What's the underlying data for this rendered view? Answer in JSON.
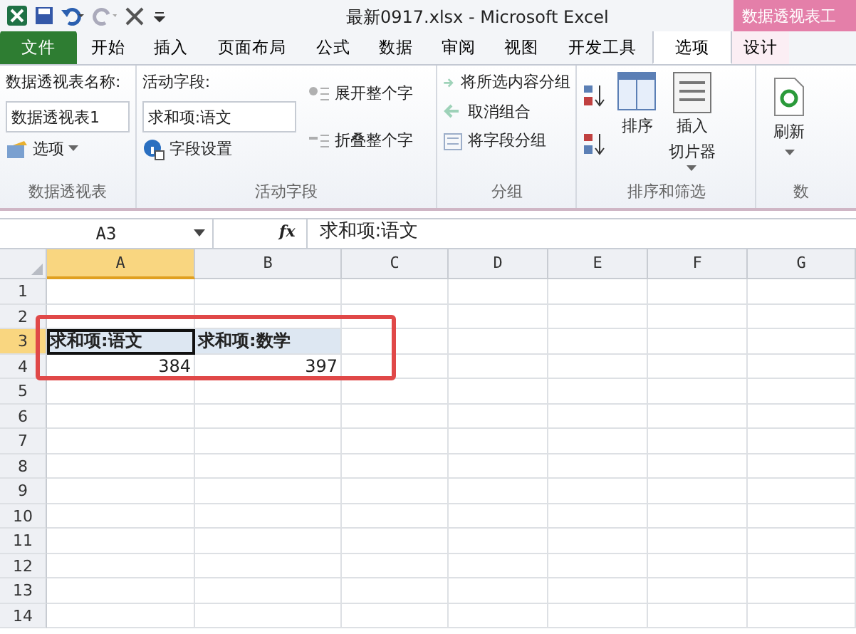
{
  "window": {
    "title": "最新0917.xlsx  -  Microsoft Excel",
    "contextual_header": "数据透视表工"
  },
  "tabs": [
    {
      "label": "文件",
      "kind": "file",
      "selected": false
    },
    {
      "label": "开始",
      "kind": "tab",
      "selected": false
    },
    {
      "label": "插入",
      "kind": "tab",
      "selected": false
    },
    {
      "label": "页面布局",
      "kind": "tab",
      "selected": false
    },
    {
      "label": "公式",
      "kind": "tab",
      "selected": false
    },
    {
      "label": "数据",
      "kind": "tab",
      "selected": false
    },
    {
      "label": "审阅",
      "kind": "tab",
      "selected": false
    },
    {
      "label": "视图",
      "kind": "tab",
      "selected": false
    },
    {
      "label": "开发工具",
      "kind": "tab",
      "selected": false
    },
    {
      "label": "选项",
      "kind": "context",
      "selected": true
    },
    {
      "label": "设计",
      "kind": "context",
      "selected": false
    }
  ],
  "ribbon": {
    "pivot_table": {
      "label": "数据透视表",
      "name_label": "数据透视表名称:",
      "name_value": "数据透视表1",
      "options_button": "选项"
    },
    "active_field": {
      "label": "活动字段",
      "field_label": "活动字段:",
      "field_value": "求和项:语文",
      "settings_button": "字段设置",
      "expand_button": {
        "label": "展开整个字",
        "disabled": true
      },
      "collapse_button": {
        "label": "折叠整个字",
        "disabled": true
      }
    },
    "group": {
      "label": "分组",
      "items": [
        {
          "label": "将所选内容分组",
          "disabled": true
        },
        {
          "label": "取消组合",
          "disabled": true
        },
        {
          "label": "将字段分组",
          "disabled": true
        }
      ]
    },
    "sort_filter": {
      "label": "排序和筛选",
      "sort_button": "排序",
      "slicer_button": [
        "插入",
        "切片器"
      ]
    },
    "data": {
      "label": "数",
      "refresh_button": "刷新"
    }
  },
  "formula_bar": {
    "name_box": "A3",
    "fx": "fx",
    "content": "求和项:语文"
  },
  "sheet": {
    "columns": [
      "A",
      "B",
      "C",
      "D",
      "E",
      "F",
      "G"
    ],
    "rows": [
      {
        "label": "1",
        "cells": []
      },
      {
        "label": "2",
        "cells": []
      },
      {
        "label": "3",
        "cells": [
          {
            "value": "求和项:语文",
            "kind": "header",
            "selected": true
          },
          {
            "value": "求和项:数学",
            "kind": "header",
            "selected": false
          }
        ]
      },
      {
        "label": "4",
        "cells": [
          {
            "value": "384",
            "kind": "number",
            "selected": false
          },
          {
            "value": "397",
            "kind": "number",
            "selected": false
          }
        ]
      },
      {
        "label": "5",
        "cells": []
      },
      {
        "label": "6",
        "cells": []
      },
      {
        "label": "7",
        "cells": []
      },
      {
        "label": "8",
        "cells": []
      },
      {
        "label": "9",
        "cells": []
      },
      {
        "label": "10",
        "cells": []
      },
      {
        "label": "11",
        "cells": []
      },
      {
        "label": "12",
        "cells": []
      },
      {
        "label": "13",
        "cells": []
      },
      {
        "label": "14",
        "cells": []
      }
    ]
  }
}
